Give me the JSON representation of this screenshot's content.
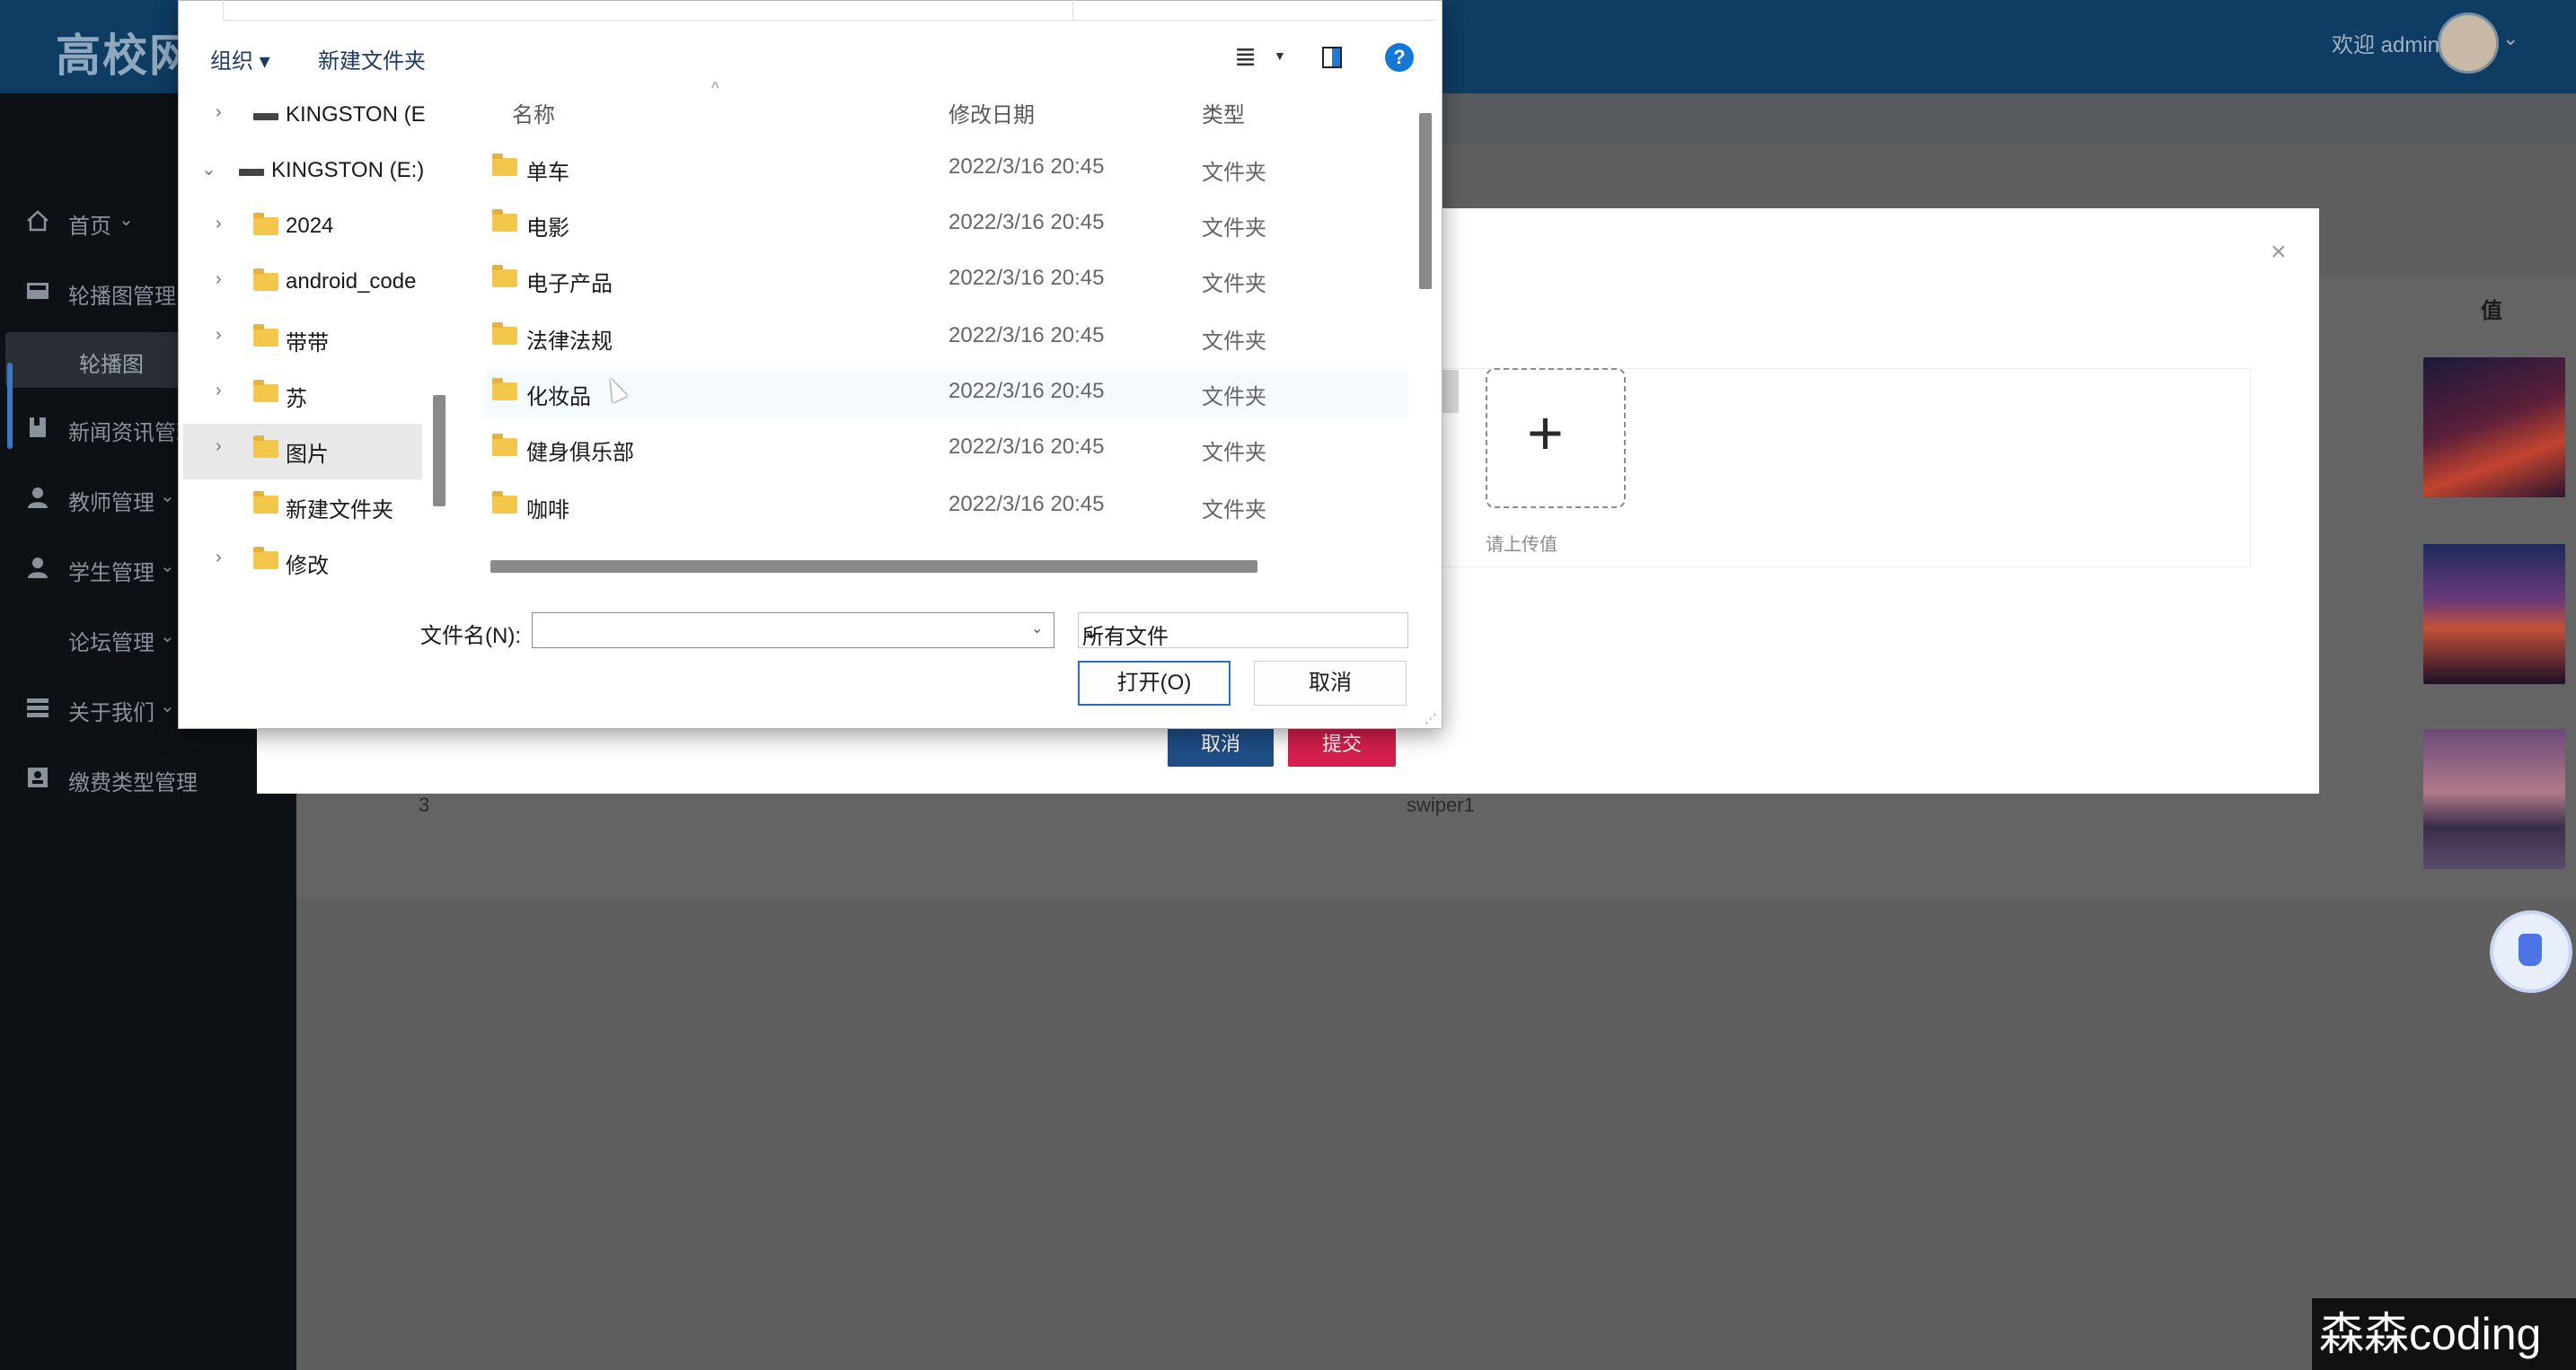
{
  "app": {
    "title": "高校网",
    "welcome": "欢迎 admin"
  },
  "sidebar": {
    "items": [
      {
        "label": "首页",
        "icon": "home-icon"
      },
      {
        "label": "轮播图管理",
        "icon": "image-icon"
      },
      {
        "label": "新闻资讯管理",
        "icon": "news-icon"
      },
      {
        "label": "教师管理",
        "icon": "user-icon"
      },
      {
        "label": "学生管理",
        "icon": "user-icon"
      },
      {
        "label": "论坛管理",
        "icon": ""
      },
      {
        "label": "关于我们",
        "icon": "list-icon"
      },
      {
        "label": "缴费类型管理",
        "icon": "card-icon"
      }
    ],
    "active_sub": "轮播图"
  },
  "table": {
    "value_header": "值",
    "row3": {
      "num": "3",
      "name": "swiper1"
    }
  },
  "modal": {
    "upload_hint": "请上传值",
    "cancel_label": "取消",
    "submit_label": "提交"
  },
  "file_dialog": {
    "toolbar": {
      "organize": "组织 ▾",
      "new_folder": "新建文件夹"
    },
    "nav": [
      {
        "label": "KINGSTON (E",
        "type": "drive",
        "expanded": false
      },
      {
        "label": "KINGSTON (E:)",
        "type": "drive",
        "expanded": true
      },
      {
        "label": "2024",
        "type": "folder"
      },
      {
        "label": "android_code",
        "type": "folder"
      },
      {
        "label": "带带",
        "type": "folder"
      },
      {
        "label": "苏",
        "type": "folder"
      },
      {
        "label": "图片",
        "type": "folder",
        "selected": true
      },
      {
        "label": "新建文件夹",
        "type": "folder"
      },
      {
        "label": "修改",
        "type": "folder"
      }
    ],
    "columns": {
      "name": "名称",
      "date": "修改日期",
      "type": "类型"
    },
    "files": [
      {
        "name": "单车",
        "date": "2022/3/16 20:45",
        "type": "文件夹"
      },
      {
        "name": "电影",
        "date": "2022/3/16 20:45",
        "type": "文件夹"
      },
      {
        "name": "电子产品",
        "date": "2022/3/16 20:45",
        "type": "文件夹"
      },
      {
        "name": "法律法规",
        "date": "2022/3/16 20:45",
        "type": "文件夹"
      },
      {
        "name": "化妆品",
        "date": "2022/3/16 20:45",
        "type": "文件夹"
      },
      {
        "name": "健身俱乐部",
        "date": "2022/3/16 20:45",
        "type": "文件夹"
      },
      {
        "name": "咖啡",
        "date": "2022/3/16 20:45",
        "type": "文件夹"
      }
    ],
    "filename_label": "文件名(N):",
    "filename_value": "",
    "filter_value": "所有文件",
    "open_label": "打开(O)",
    "cancel_label": "取消"
  },
  "watermark": "森森coding",
  "colors": {
    "topbar": "#0f3c63",
    "sidebar": "#0d1116",
    "primary_button": "#1f4e86",
    "danger_button": "#d51f4c",
    "folder": "#f3c64c",
    "dialog_accent": "#1478d4"
  }
}
